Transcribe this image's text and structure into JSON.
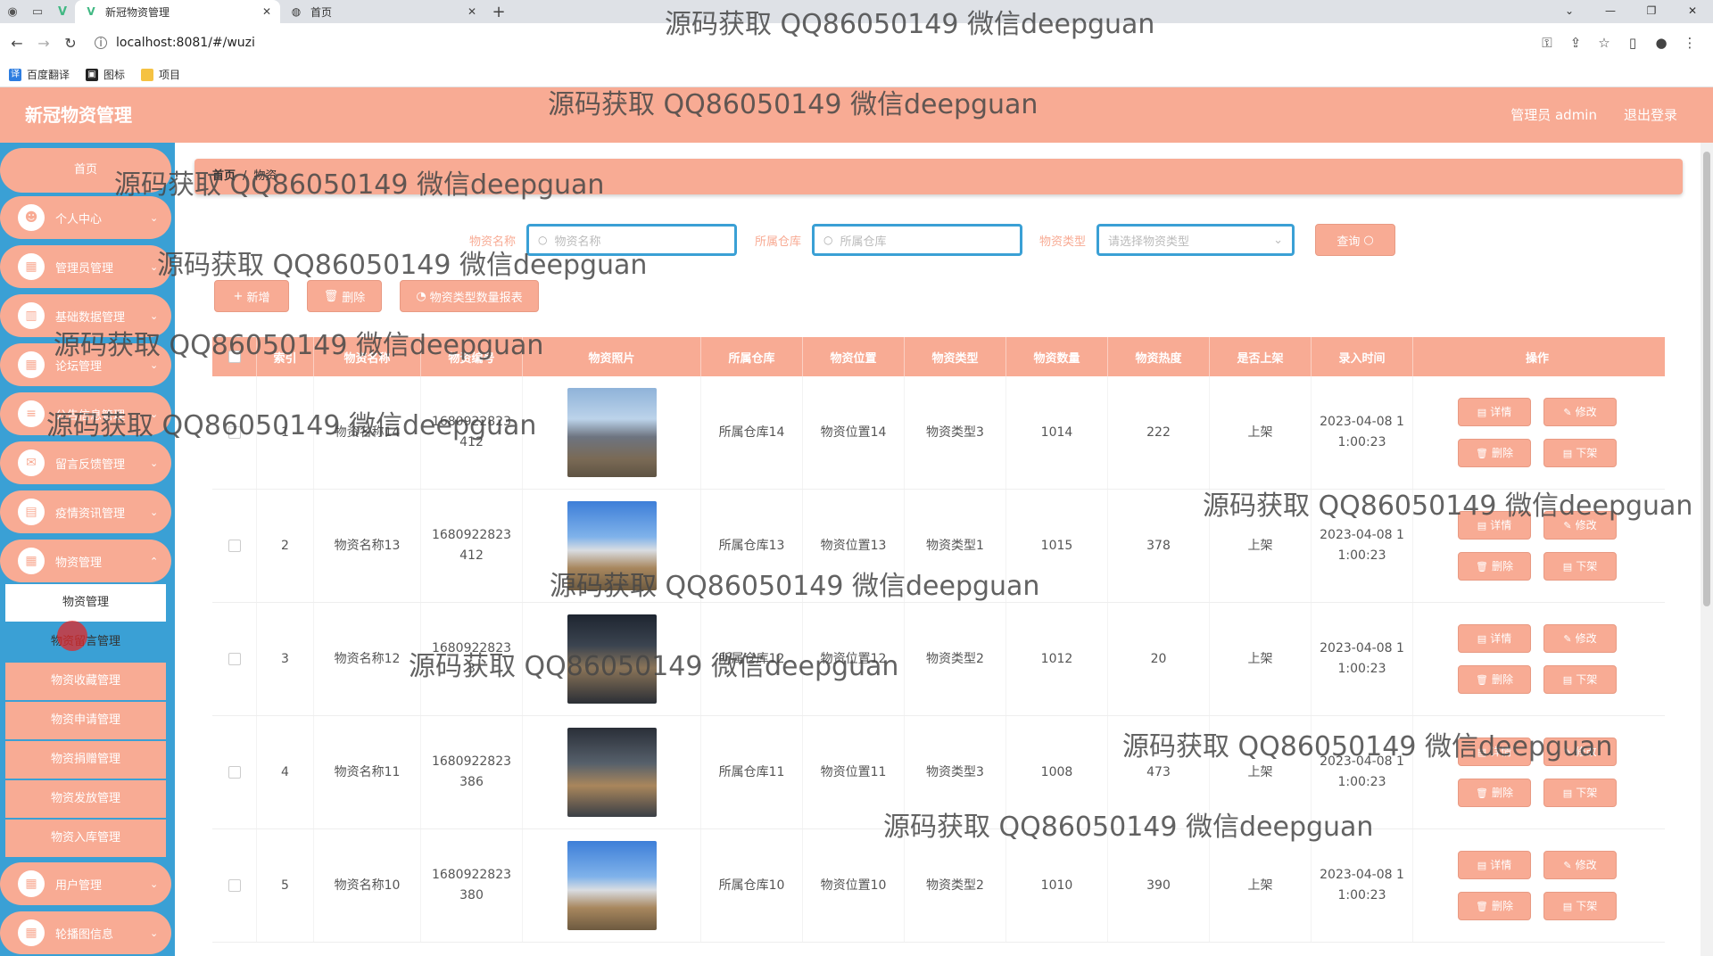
{
  "browser": {
    "tabs": [
      {
        "label": "新冠物资管理",
        "active": true,
        "favicon": "vue-icon"
      },
      {
        "label": "首页",
        "active": false,
        "favicon": "globe-icon"
      }
    ],
    "url": "localhost:8081/#/wuzi",
    "bookmarks": [
      "百度翻译",
      "图标",
      "项目"
    ]
  },
  "header": {
    "title": "新冠物资管理",
    "user_label": "管理员 admin",
    "logout_label": "退出登录"
  },
  "sidebar": {
    "home": "首页",
    "menus": [
      {
        "label": "个人中心",
        "icon": "person-icon"
      },
      {
        "label": "管理员管理",
        "icon": "grid-icon"
      },
      {
        "label": "基础数据管理",
        "icon": "chart-icon"
      },
      {
        "label": "论坛管理",
        "icon": "grid-icon"
      },
      {
        "label": "公告信息管理",
        "icon": "list-icon"
      },
      {
        "label": "留言反馈管理",
        "icon": "message-icon"
      },
      {
        "label": "疫情资讯管理",
        "icon": "news-icon"
      },
      {
        "label": "物资管理",
        "icon": "grid-icon"
      }
    ],
    "submenu": [
      "物资管理",
      "物资留言管理",
      "物资收藏管理",
      "物资申请管理",
      "物资捐赠管理",
      "物资发放管理",
      "物资入库管理"
    ],
    "menus_after": [
      {
        "label": "用户管理",
        "icon": "grid-icon"
      },
      {
        "label": "轮播图信息",
        "icon": "grid-icon"
      }
    ]
  },
  "breadcrumb": {
    "home": "首页",
    "separator": "/",
    "current": "物资"
  },
  "search": {
    "name_label": "物资名称",
    "name_placeholder": "物资名称",
    "warehouse_label": "所属仓库",
    "warehouse_placeholder": "所属仓库",
    "type_label": "物资类型",
    "type_placeholder": "请选择物资类型",
    "query_button": "查询"
  },
  "toolbar": {
    "add": "新增",
    "delete": "删除",
    "report": "物资类型数量报表"
  },
  "table": {
    "headers": [
      "索引",
      "物资名称",
      "物资编号",
      "物资照片",
      "所属仓库",
      "物资位置",
      "物资类型",
      "物资数量",
      "物资热度",
      "是否上架",
      "录入时间",
      "操作"
    ],
    "rows": [
      {
        "index": "1",
        "name": "物资名称14",
        "code": "1680922823412",
        "warehouse": "所属仓库14",
        "location": "物资位置14",
        "type": "物资类型3",
        "qty": "1014",
        "heat": "222",
        "status": "上架",
        "time": "2023-04-08 11:00:23"
      },
      {
        "index": "2",
        "name": "物资名称13",
        "code": "1680922823412",
        "warehouse": "所属仓库13",
        "location": "物资位置13",
        "type": "物资类型1",
        "qty": "1015",
        "heat": "378",
        "status": "上架",
        "time": "2023-04-08 11:00:23"
      },
      {
        "index": "3",
        "name": "物资名称12",
        "code": "16809228233",
        "warehouse": "所属仓库12",
        "location": "物资位置12",
        "type": "物资类型2",
        "qty": "1012",
        "heat": "20",
        "status": "上架",
        "time": "2023-04-08 11:00:23"
      },
      {
        "index": "4",
        "name": "物资名称11",
        "code": "1680922823386",
        "warehouse": "所属仓库11",
        "location": "物资位置11",
        "type": "物资类型3",
        "qty": "1008",
        "heat": "473",
        "status": "上架",
        "time": "2023-04-08 11:00:23"
      },
      {
        "index": "5",
        "name": "物资名称10",
        "code": "1680922823380",
        "warehouse": "所属仓库10",
        "location": "物资位置10",
        "type": "物资类型2",
        "qty": "1010",
        "heat": "390",
        "status": "上架",
        "time": "2023-04-08 11:00:23"
      }
    ],
    "actions": {
      "detail": "详情",
      "edit": "修改",
      "delete": "删除",
      "offline": "下架"
    }
  },
  "watermark": "源码获取 QQ86050149 微信deepguan",
  "colors": {
    "accent": "#f8ab94",
    "sidebar": "#3aa0d5"
  }
}
